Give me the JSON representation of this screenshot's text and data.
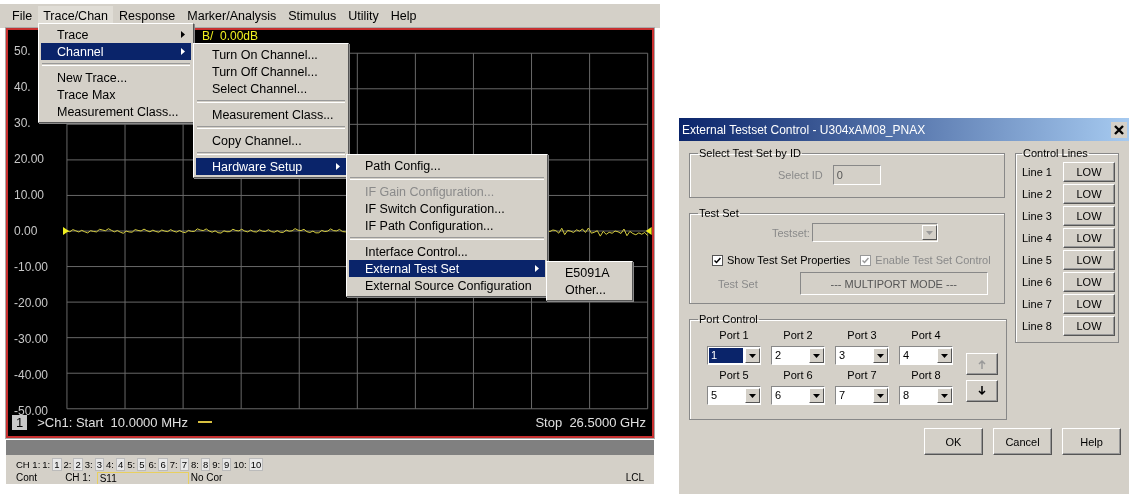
{
  "analyzer": {
    "menubar": [
      {
        "label": "File",
        "selected": false
      },
      {
        "label": "Trace/Chan",
        "selected": true
      },
      {
        "label": "Response",
        "selected": false
      },
      {
        "label": "Marker/Analysis",
        "selected": false
      },
      {
        "label": "Stimulus",
        "selected": false
      },
      {
        "label": "Utility",
        "selected": false
      },
      {
        "label": "Help",
        "selected": false
      }
    ],
    "menus": [
      {
        "items": [
          {
            "kind": "item",
            "label": "Trace",
            "submenu": true,
            "selected": false,
            "disabled": false
          },
          {
            "kind": "item",
            "label": "Channel",
            "submenu": true,
            "selected": true,
            "disabled": false
          },
          {
            "kind": "separator"
          },
          {
            "kind": "item",
            "label": "New Trace...",
            "submenu": false,
            "selected": false,
            "disabled": false
          },
          {
            "kind": "item",
            "label": "Trace Max",
            "submenu": false,
            "selected": false,
            "disabled": false
          },
          {
            "kind": "item",
            "label": "Measurement Class...",
            "submenu": false,
            "selected": false,
            "disabled": false
          }
        ]
      },
      {
        "items": [
          {
            "kind": "item",
            "label": "Turn On Channel...",
            "submenu": false,
            "selected": false,
            "disabled": false
          },
          {
            "kind": "item",
            "label": "Turn Off Channel...",
            "submenu": false,
            "selected": false,
            "disabled": false
          },
          {
            "kind": "item",
            "label": "Select Channel...",
            "submenu": false,
            "selected": false,
            "disabled": false
          },
          {
            "kind": "separator"
          },
          {
            "kind": "item",
            "label": "Measurement Class...",
            "submenu": false,
            "selected": false,
            "disabled": false
          },
          {
            "kind": "separator"
          },
          {
            "kind": "item",
            "label": "Copy Channel...",
            "submenu": false,
            "selected": false,
            "disabled": false
          },
          {
            "kind": "separator"
          },
          {
            "kind": "item",
            "label": "Hardware Setup",
            "submenu": true,
            "selected": true,
            "disabled": false
          }
        ]
      },
      {
        "items": [
          {
            "kind": "item",
            "label": "Path Config...",
            "submenu": false,
            "selected": false,
            "disabled": false
          },
          {
            "kind": "separator"
          },
          {
            "kind": "item",
            "label": "IF Gain Configuration...",
            "submenu": false,
            "selected": false,
            "disabled": true
          },
          {
            "kind": "item",
            "label": "IF Switch Configuration...",
            "submenu": false,
            "selected": false,
            "disabled": false
          },
          {
            "kind": "item",
            "label": "IF Path Configuration...",
            "submenu": false,
            "selected": false,
            "disabled": false
          },
          {
            "kind": "separator"
          },
          {
            "kind": "item",
            "label": "Interface Control...",
            "submenu": false,
            "selected": false,
            "disabled": false
          },
          {
            "kind": "item",
            "label": "External Test Set",
            "submenu": true,
            "selected": true,
            "disabled": false
          },
          {
            "kind": "item",
            "label": "External Source Configuration",
            "submenu": false,
            "selected": false,
            "disabled": false
          }
        ]
      },
      {
        "items": [
          {
            "kind": "item",
            "label": "E5091A",
            "submenu": false,
            "selected": false,
            "disabled": false
          },
          {
            "kind": "item",
            "label": "Other...",
            "submenu": false,
            "selected": false,
            "disabled": false
          }
        ]
      }
    ],
    "scale": "B/  0.00dB",
    "y_axis_labels": [
      "50.",
      "40.",
      "30.",
      "20.00",
      "10.00",
      "0.00",
      "-10.00",
      "-20.00",
      "-30.00",
      "-40.00",
      "-50.00"
    ],
    "channel_number": "1",
    "start": ">Ch1: Start  10.0000 MHz",
    "stop": "Stop  26.5000 GHz",
    "channel_prefix": "CH 1:",
    "channel_tabs": [
      {
        "label": "1:",
        "value": "1"
      },
      {
        "label": "2:",
        "value": "2"
      },
      {
        "label": "3:",
        "value": "3"
      },
      {
        "label": "4:",
        "value": "4"
      },
      {
        "label": "5:",
        "value": "5"
      },
      {
        "label": "6:",
        "value": "6"
      },
      {
        "label": "7:",
        "value": "7"
      },
      {
        "label": "8:",
        "value": "8"
      },
      {
        "label": "9:",
        "value": "9"
      },
      {
        "label": "10:",
        "value": "10"
      }
    ],
    "status": {
      "mode": "Cont",
      "channel": "CH 1:",
      "measurement": "S11",
      "correction": "No Cor",
      "control": "LCL"
    }
  },
  "dialog": {
    "title": "External Testset Control - U304xAM08_PNAX",
    "select_group": {
      "title": "Select Test Set by ID",
      "label": "Select ID",
      "value": "0",
      "disabled": true
    },
    "testset_group": {
      "title": "Test Set",
      "testset_label": "Testset:",
      "disabled": true,
      "checkboxes": [
        {
          "label": "Show Test Set Properties",
          "checked": true,
          "disabled": false
        },
        {
          "label": "Enable Test Set Control",
          "checked": true,
          "disabled": true
        }
      ],
      "mode_label": "Test Set",
      "mode_value": "--- MULTIPORT MODE ---"
    },
    "port_group": {
      "title": "Port Control",
      "ports": [
        {
          "label": "Port 1",
          "value": "1",
          "selected": true
        },
        {
          "label": "Port 2",
          "value": "2",
          "selected": false
        },
        {
          "label": "Port 3",
          "value": "3",
          "selected": false
        },
        {
          "label": "Port 4",
          "value": "4",
          "selected": false
        },
        {
          "label": "Port 5",
          "value": "5",
          "selected": false
        },
        {
          "label": "Port 6",
          "value": "6",
          "selected": false
        },
        {
          "label": "Port 7",
          "value": "7",
          "selected": false
        },
        {
          "label": "Port 8",
          "value": "8",
          "selected": false
        }
      ],
      "move_buttons": [
        {
          "kind": "up",
          "disabled": true
        },
        {
          "kind": "down",
          "disabled": false
        }
      ]
    },
    "control_lines": {
      "title": "Control Lines",
      "lines": [
        {
          "label": "Line 1",
          "value": "LOW"
        },
        {
          "label": "Line 2",
          "value": "LOW"
        },
        {
          "label": "Line 3",
          "value": "LOW"
        },
        {
          "label": "Line 4",
          "value": "LOW"
        },
        {
          "label": "Line 5",
          "value": "LOW"
        },
        {
          "label": "Line 6",
          "value": "LOW"
        },
        {
          "label": "Line 7",
          "value": "LOW"
        },
        {
          "label": "Line 8",
          "value": "LOW"
        }
      ]
    },
    "buttons": [
      "OK",
      "Cancel",
      "Help"
    ]
  }
}
